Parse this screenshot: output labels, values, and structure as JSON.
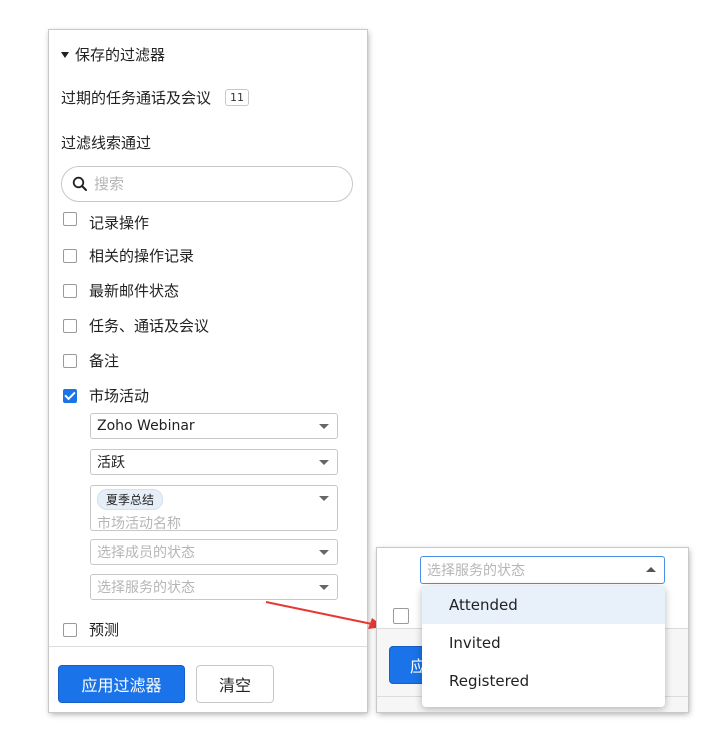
{
  "saved_filters": {
    "header": "保存的过滤器",
    "items": [
      {
        "label": "过期的任务通话及会议",
        "count": "11"
      }
    ]
  },
  "filter_by": {
    "heading": "过滤线索通过",
    "search_placeholder": "搜索",
    "items": [
      {
        "label": "记录操作",
        "checked": false
      },
      {
        "label": "相关的操作记录",
        "checked": false
      },
      {
        "label": "最新邮件状态",
        "checked": false
      },
      {
        "label": "任务、通话及会议",
        "checked": false
      },
      {
        "label": "备注",
        "checked": false
      },
      {
        "label": "市场活动",
        "checked": true
      }
    ],
    "campaign": {
      "type_value": "Zoho Webinar",
      "status_value": "活跃",
      "selected_campaign": "夏季总结",
      "campaign_name_placeholder": "市场活动名称",
      "member_status_placeholder": "选择成员的状态",
      "service_status_placeholder": "选择服务的状态"
    },
    "forecast_label": "预测"
  },
  "footer": {
    "apply_label": "应用过滤器",
    "clear_label": "清空"
  },
  "zoom": {
    "select_placeholder": "选择服务的状态",
    "button_partial": "应",
    "options": [
      "Attended",
      "Invited",
      "Registered"
    ],
    "highlighted": "Attended"
  },
  "colors": {
    "accent": "#1a73e8",
    "arrow": "#e53935",
    "highlight": "#e8f0fa"
  }
}
